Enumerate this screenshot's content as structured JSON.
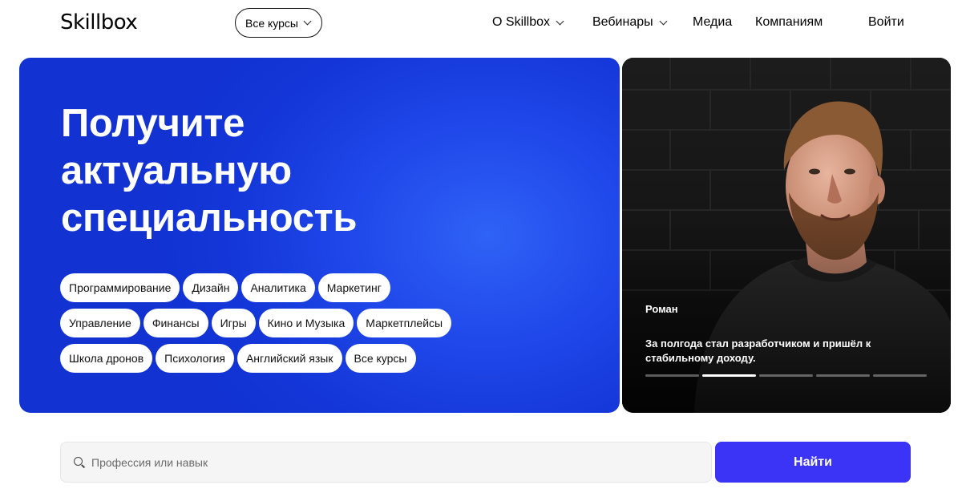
{
  "header": {
    "logo": "Skillbox",
    "all_courses_label": "Все курсы",
    "nav": {
      "about": "О Skillbox",
      "webinars": "Вебинары",
      "media": "Медиа",
      "companies": "Компаниям",
      "login": "Войти"
    }
  },
  "hero": {
    "title_lines": [
      "Получите",
      "актуальную",
      "специальность"
    ],
    "tags": [
      [
        "Программирование",
        "Дизайн",
        "Аналитика",
        "Маркетинг"
      ],
      [
        "Управление",
        "Финансы",
        "Игры",
        "Кино и Музыка",
        "Маркетплейсы"
      ],
      [
        "Школа дронов",
        "Психология",
        "Английский язык",
        "Все курсы"
      ]
    ]
  },
  "testimonial": {
    "name": "Роман",
    "quote": "За полгода стал разработчиком и пришёл к стабильному доходу.",
    "slides_total": 5,
    "active_slide": 2
  },
  "search": {
    "placeholder": "Профессия или навык",
    "value": "",
    "button_label": "Найти"
  },
  "colors": {
    "hero_blue": "#1437d9",
    "accent_button": "#3b33f5"
  }
}
